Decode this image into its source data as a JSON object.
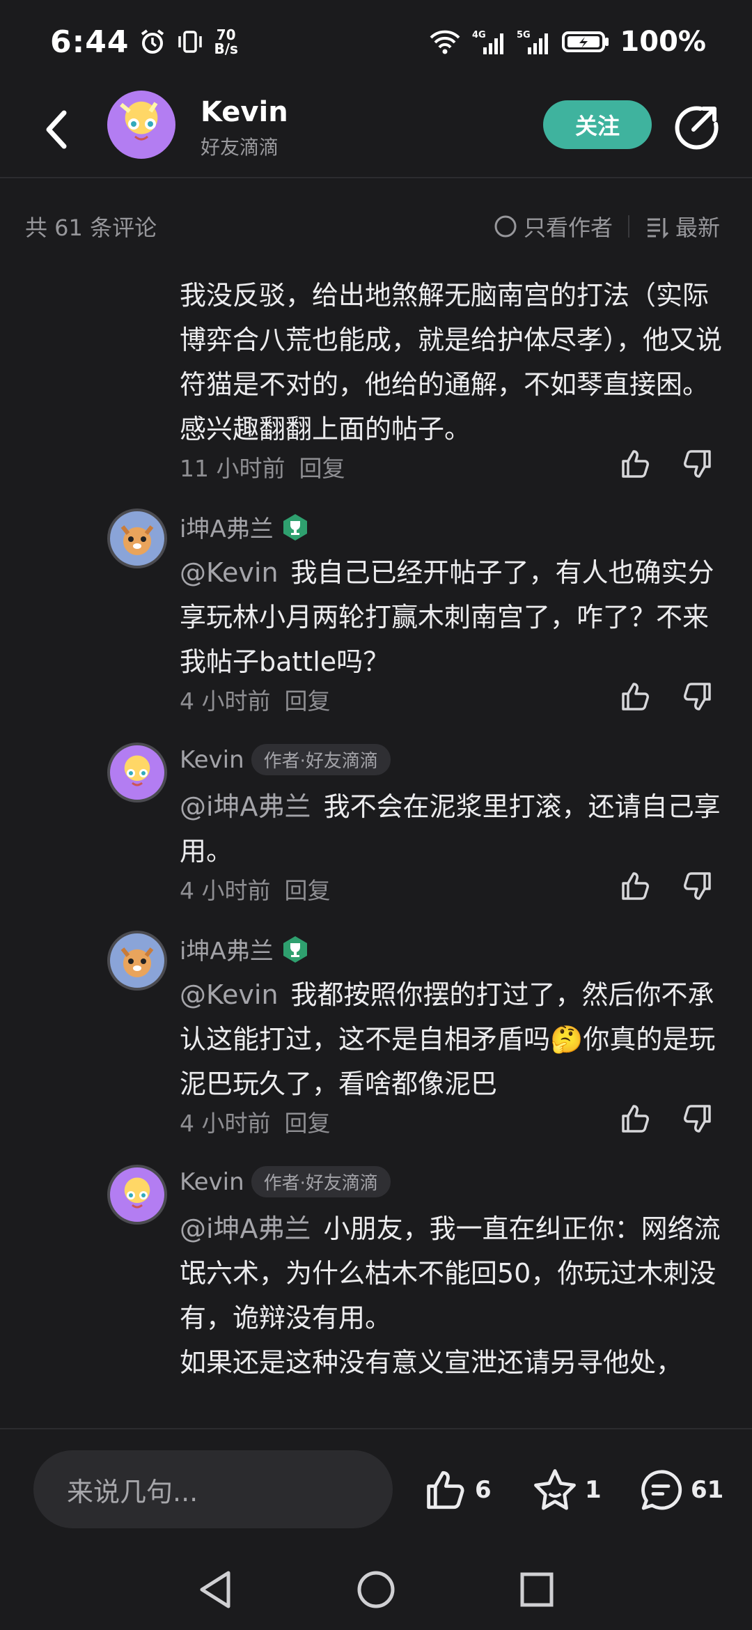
{
  "status_bar": {
    "time": "6:44",
    "net_speed_value": "70",
    "net_speed_unit": "B/s",
    "battery": "100%"
  },
  "header": {
    "name": "Kevin",
    "subtitle": "好友滴滴",
    "follow_label": "关注"
  },
  "comment_bar": {
    "count_text": "共 61 条评论",
    "filter_author": "只看作者",
    "filter_newest": "最新"
  },
  "comments": [
    {
      "text": "我没反驳，给出地煞解无脑南宫的打法（实际博弈合八荒也能成，就是给护体尽孝），他又说符猫是不对的，他给的通解，不如琴直接困。感兴趣翻翻上面的帖子。",
      "time": "11 小时前",
      "reply": "回复"
    },
    {
      "user": "i坤A弗兰",
      "mention": "@Kevin",
      "text": "我自己已经开帖子了，有人也确实分享玩林小月两轮打赢木刺南宫了，咋了？不来我帖子battle吗？",
      "time": "4 小时前",
      "reply": "回复"
    },
    {
      "user": "Kevin",
      "tag": "作者·好友滴滴",
      "mention": "@i坤A弗兰",
      "text": "我不会在泥浆里打滚，还请自己享用。",
      "time": "4 小时前",
      "reply": "回复"
    },
    {
      "user": "i坤A弗兰",
      "mention": "@Kevin",
      "text_a": "我都按照你摆的打过了，然后你不承认这能打过，这不是自相矛盾吗",
      "emoji": "🤔",
      "text_b": "你真的是玩泥巴玩久了，看啥都像泥巴",
      "time": "4 小时前",
      "reply": "回复"
    },
    {
      "user": "Kevin",
      "tag": "作者·好友滴滴",
      "mention": "@i坤A弗兰",
      "text": "小朋友，我一直在纠正你：网络流氓六术，为什么枯木不能回50，你玩过木刺没有，诡辩没有用。",
      "text_2": "如果还是这种没有意义宣泄还请另寻他处，"
    }
  ],
  "bottom_bar": {
    "input_placeholder": "来说几句...",
    "like_count": "6",
    "fav_count": "1",
    "comment_count": "61"
  },
  "colors": {
    "background": "#1b1b1d",
    "accent": "#3fb39e",
    "badge_green": "#2fa06f"
  }
}
